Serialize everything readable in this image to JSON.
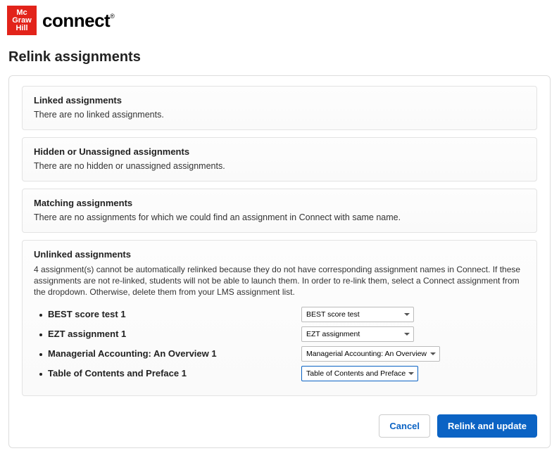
{
  "brand": {
    "mhe_line1": "Mc",
    "mhe_line2": "Graw",
    "mhe_line3": "Hill",
    "connect": "connect",
    "reg": "®"
  },
  "page_title": "Relink assignments",
  "sections": {
    "linked": {
      "header": "Linked assignments",
      "body": "There are no linked assignments."
    },
    "hidden": {
      "header": "Hidden or Unassigned assignments",
      "body": "There are no hidden or unassigned assignments."
    },
    "matching": {
      "header": "Matching assignments",
      "body": "There are no assignments for which we could find an assignment in Connect with same name."
    },
    "unlinked": {
      "header": "Unlinked assignments",
      "help": "4 assignment(s) cannot be automatically relinked because they do not have corresponding assignment names in Connect. If these assignments are not re-linked, students will not be able to launch them. In order to re-link them, select a Connect assignment from the dropdown. Otherwise, delete them from your LMS assignment list.",
      "items": [
        {
          "label": "BEST score test 1",
          "selected": "BEST score test"
        },
        {
          "label": "EZT assignment 1",
          "selected": "EZT assignment"
        },
        {
          "label": "Managerial Accounting: An Overview 1",
          "selected": "Managerial Accounting: An Overview"
        },
        {
          "label": "Table of Contents and Preface 1",
          "selected": "Table of Contents and Preface"
        }
      ]
    }
  },
  "buttons": {
    "cancel": "Cancel",
    "relink": "Relink and update"
  }
}
